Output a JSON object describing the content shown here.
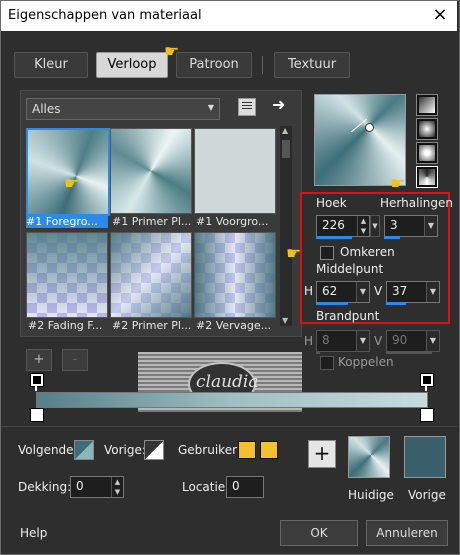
{
  "dialog": {
    "title": "Eigenschappen van materiaal",
    "close_icon": "×"
  },
  "tabs": [
    {
      "label": "Kleur",
      "active": false
    },
    {
      "label": "Verloop",
      "active": true
    },
    {
      "label": "Patroon",
      "active": false
    },
    {
      "label": "Textuur",
      "active": false
    }
  ],
  "library": {
    "category": "Alles",
    "items": [
      {
        "label": "#1 Foregro...",
        "selected": true
      },
      {
        "label": "#1 Primer Pl...",
        "selected": false
      },
      {
        "label": "#1 Voorgro...",
        "selected": false
      },
      {
        "label": "#2 Fading F...",
        "selected": false
      },
      {
        "label": "#2 Primer Pl...",
        "selected": false
      },
      {
        "label": "#2 Vervage...",
        "selected": false
      }
    ],
    "add_label": "+",
    "remove_label": "-"
  },
  "gradient": {
    "angle_label": "Hoek",
    "angle_value": "226",
    "repeats_label": "Herhalingen",
    "repeats_value": "3",
    "invert_label": "Omkeren",
    "invert_checked": false,
    "midpoint_label": "Middelpunt",
    "h_label": "H",
    "h_value": "62",
    "v_label": "V",
    "v_value": "37",
    "focal_label": "Brandpunt",
    "fh_label": "H",
    "fh_value": "8",
    "fv_label": "V",
    "fv_value": "90",
    "link_label": "Koppelen",
    "link_checked": false,
    "color_dark": "#3e6e78",
    "color_light": "#cfe0e2"
  },
  "editor": {
    "next_label": "Volgende:",
    "previous_label": "Vorige:",
    "user_label": "Gebruiker:",
    "opacity_label": "Dekking:",
    "opacity_value": "0",
    "location_label": "Locatie:",
    "location_value": "0",
    "user_color": "#f2c12b"
  },
  "previews": {
    "add_label": "+",
    "current_label": "Huidige",
    "previous_label": "Vorige",
    "previous_color": "#3b5f6b"
  },
  "watermark": {
    "text": "claudia"
  },
  "footer": {
    "help_label": "Help",
    "ok_label": "OK",
    "cancel_label": "Annuleren"
  }
}
